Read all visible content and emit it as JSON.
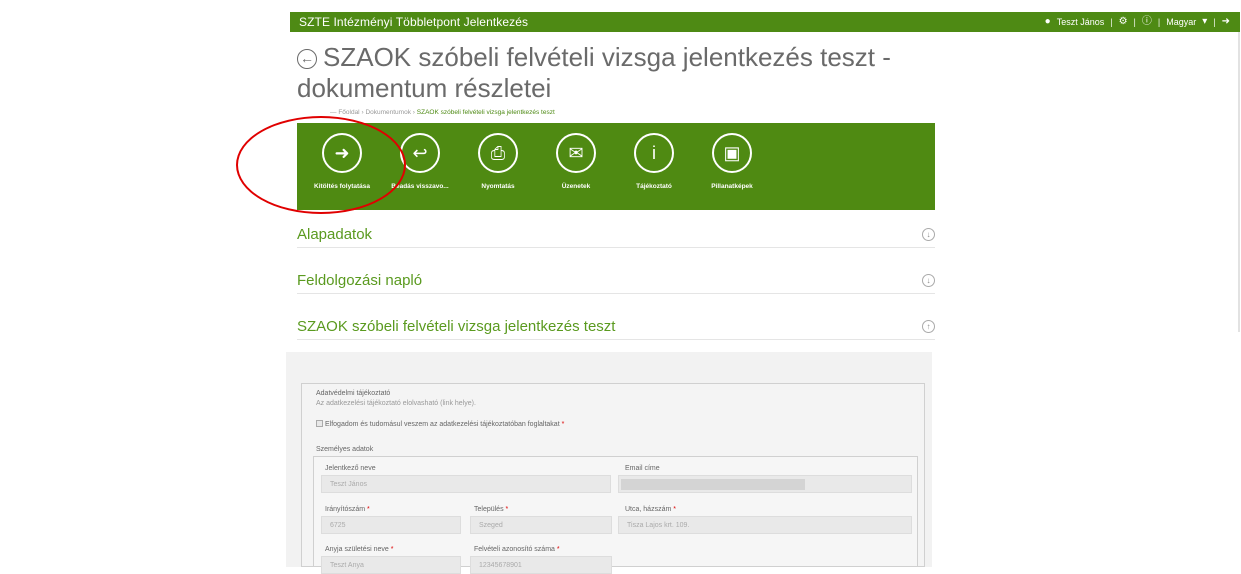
{
  "topbar": {
    "app_title": "SZTE Intézményi Többletpont Jelentkezés",
    "user_name": "Teszt János",
    "language": "Magyar"
  },
  "page": {
    "title": "SZAOK szóbeli felvételi vizsga jelentkezés teszt - dokumentum részletei"
  },
  "breadcrumb": {
    "home": "Főoldal",
    "documents": "Dokumentumok",
    "current": "SZAOK szóbeli felvételi vizsga jelentkezés teszt"
  },
  "toolbar": {
    "items": [
      {
        "label": "Kitöltés folytatása",
        "icon": "arrow-edit-icon"
      },
      {
        "label": "Beadás visszavo...",
        "icon": "withdraw-icon"
      },
      {
        "label": "Nyomtatás",
        "icon": "printer-icon"
      },
      {
        "label": "Üzenetek",
        "icon": "message-icon"
      },
      {
        "label": "Tájékoztató",
        "icon": "info-icon"
      },
      {
        "label": "Pillanatképek",
        "icon": "snapshot-icon"
      }
    ]
  },
  "sections": [
    {
      "title": "Alapadatok",
      "state": "collapsed"
    },
    {
      "title": "Feldolgozási napló",
      "state": "collapsed"
    },
    {
      "title": "SZAOK szóbeli felvételi vizsga jelentkezés teszt",
      "state": "expanded"
    }
  ],
  "form": {
    "privacy_title": "Adatvédelmi tájékoztató",
    "privacy_text": "Az adatkezelési tájékoztató elolvasható (link helye).",
    "consent_label": "Elfogadom és tudomásul veszem az adatkezelési tájékoztatóban foglaltakat",
    "personal_title": "Személyes adatok",
    "name_label": "Jelentkező neve",
    "name_value": "Teszt János",
    "email_label": "Email címe",
    "zip_label": "Irányítószám",
    "zip_value": "6725",
    "city_label": "Település",
    "city_value": "Szeged",
    "street_label": "Utca, házszám",
    "street_value": "Tisza Lajos krt. 109.",
    "mother_label": "Anyja születési neve",
    "mother_value": "Teszt Anya",
    "admission_label": "Felvételi azonosító száma",
    "admission_value": "12345678901"
  },
  "colors": {
    "brand_green": "#4e8a14",
    "annotation_red": "#e00000"
  }
}
